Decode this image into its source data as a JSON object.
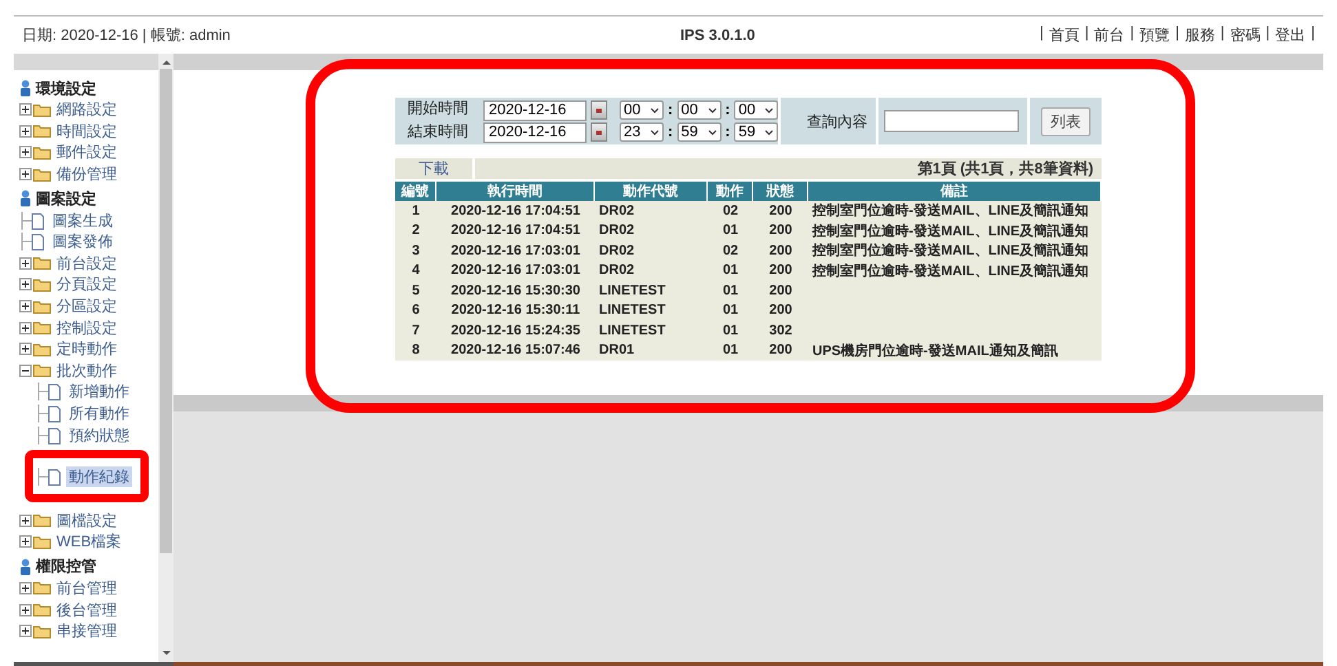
{
  "header": {
    "date_account": "日期: 2020-12-16 | 帳號: admin",
    "version": "IPS 3.0.1.0",
    "separator": "|",
    "links": [
      "首頁",
      "前台",
      "預覽",
      "服務",
      "密碼",
      "登出"
    ]
  },
  "sidebar": {
    "groups": [
      {
        "label": "環境設定",
        "items": [
          {
            "label": "網路設定",
            "kind": "folder",
            "expanded": false
          },
          {
            "label": "時間設定",
            "kind": "folder",
            "expanded": false
          },
          {
            "label": "郵件設定",
            "kind": "folder",
            "expanded": false
          },
          {
            "label": "備份管理",
            "kind": "folder",
            "expanded": false
          }
        ]
      },
      {
        "label": "圖案設定",
        "items": [
          {
            "label": "圖案生成",
            "kind": "page",
            "selected": false
          },
          {
            "label": "圖案發佈",
            "kind": "page",
            "selected": false
          },
          {
            "label": "前台設定",
            "kind": "folder",
            "expanded": false
          },
          {
            "label": "分頁設定",
            "kind": "folder",
            "expanded": false
          },
          {
            "label": "分區設定",
            "kind": "folder",
            "expanded": false
          },
          {
            "label": "控制設定",
            "kind": "folder",
            "expanded": false
          },
          {
            "label": "定時動作",
            "kind": "folder",
            "expanded": false
          },
          {
            "label": "批次動作",
            "kind": "folder",
            "expanded": true,
            "children": [
              {
                "label": "新增動作",
                "kind": "page",
                "selected": false
              },
              {
                "label": "所有動作",
                "kind": "page",
                "selected": false
              },
              {
                "label": "預約狀態",
                "kind": "page",
                "selected": false
              },
              {
                "label": "動作紀錄",
                "kind": "page",
                "selected": true
              }
            ]
          },
          {
            "label": "圖檔設定",
            "kind": "folder",
            "expanded": false
          },
          {
            "label": "WEB檔案",
            "kind": "folder",
            "expanded": false
          }
        ]
      },
      {
        "label": "權限控管",
        "items": [
          {
            "label": "前台管理",
            "kind": "folder",
            "expanded": false
          },
          {
            "label": "後台管理",
            "kind": "folder",
            "expanded": false
          },
          {
            "label": "串接管理",
            "kind": "folder",
            "expanded": false
          }
        ]
      }
    ]
  },
  "form": {
    "time_separator": ":",
    "start": {
      "label": "開始時間",
      "date": "2020-12-16",
      "time": [
        "00",
        "00",
        "00"
      ]
    },
    "end": {
      "label": "結束時間",
      "date": "2020-12-16",
      "time": [
        "23",
        "59",
        "59"
      ]
    },
    "query_label": "查詢內容",
    "button": "列表"
  },
  "toolbar": {
    "download": "下載",
    "page_info": "第1頁 (共1頁，共8筆資料)"
  },
  "table": {
    "columns": [
      "編號",
      "執行時間",
      "動作代號",
      "動作",
      "狀態",
      "備註"
    ],
    "rows": [
      [
        "1",
        "2020-12-16 17:04:51",
        "DR02",
        "02",
        "200",
        "控制室門位逾時-發送MAIL、LINE及簡訊通知"
      ],
      [
        "2",
        "2020-12-16 17:04:51",
        "DR02",
        "01",
        "200",
        "控制室門位逾時-發送MAIL、LINE及簡訊通知"
      ],
      [
        "3",
        "2020-12-16 17:03:01",
        "DR02",
        "02",
        "200",
        "控制室門位逾時-發送MAIL、LINE及簡訊通知"
      ],
      [
        "4",
        "2020-12-16 17:03:01",
        "DR02",
        "01",
        "200",
        "控制室門位逾時-發送MAIL、LINE及簡訊通知"
      ],
      [
        "5",
        "2020-12-16 15:30:30",
        "LINETEST",
        "01",
        "200",
        ""
      ],
      [
        "6",
        "2020-12-16 15:30:11",
        "LINETEST",
        "01",
        "200",
        ""
      ],
      [
        "7",
        "2020-12-16 15:24:35",
        "LINETEST",
        "01",
        "302",
        ""
      ],
      [
        "8",
        "2020-12-16 15:07:46",
        "DR01",
        "01",
        "200",
        "UPS機房門位逾時-發送MAIL通知及簡訊"
      ]
    ]
  }
}
